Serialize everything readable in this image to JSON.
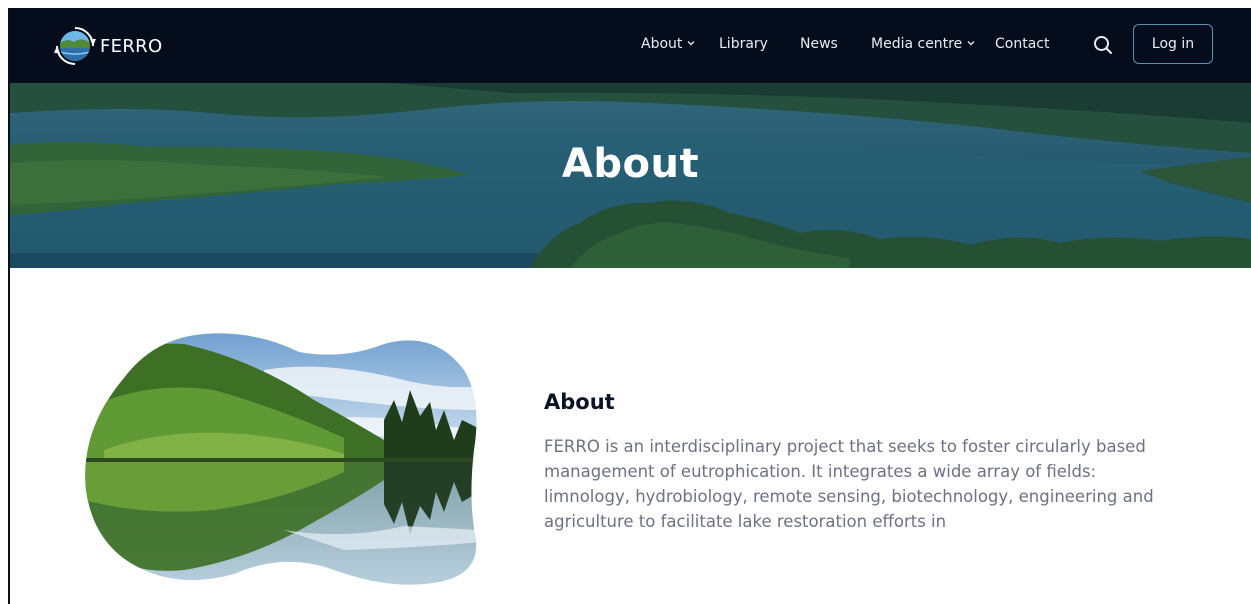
{
  "brand": {
    "name": "FERRO",
    "logo_icon": "ferro-globe-logo"
  },
  "nav": {
    "items": [
      {
        "label": "About",
        "has_dropdown": true
      },
      {
        "label": "Library",
        "has_dropdown": false
      },
      {
        "label": "News",
        "has_dropdown": false
      },
      {
        "label": "Media centre",
        "has_dropdown": true
      },
      {
        "label": "Contact",
        "has_dropdown": false
      }
    ],
    "search_icon": "search-icon",
    "login_label": "Log in"
  },
  "hero": {
    "title": "About"
  },
  "about": {
    "heading": "About",
    "body": "FERRO is an interdisciplinary project that seeks to foster circularly based management of eutrophication. It integrates a wide array of fields: limnology, hydrobiology, remote sensing, biotechnology, engineering and agriculture to facilitate lake restoration efforts in"
  },
  "colors": {
    "navbar": "#050c1c",
    "accent": "#5d8fb8",
    "heading": "#0b1424",
    "body_text": "#6b7280"
  }
}
